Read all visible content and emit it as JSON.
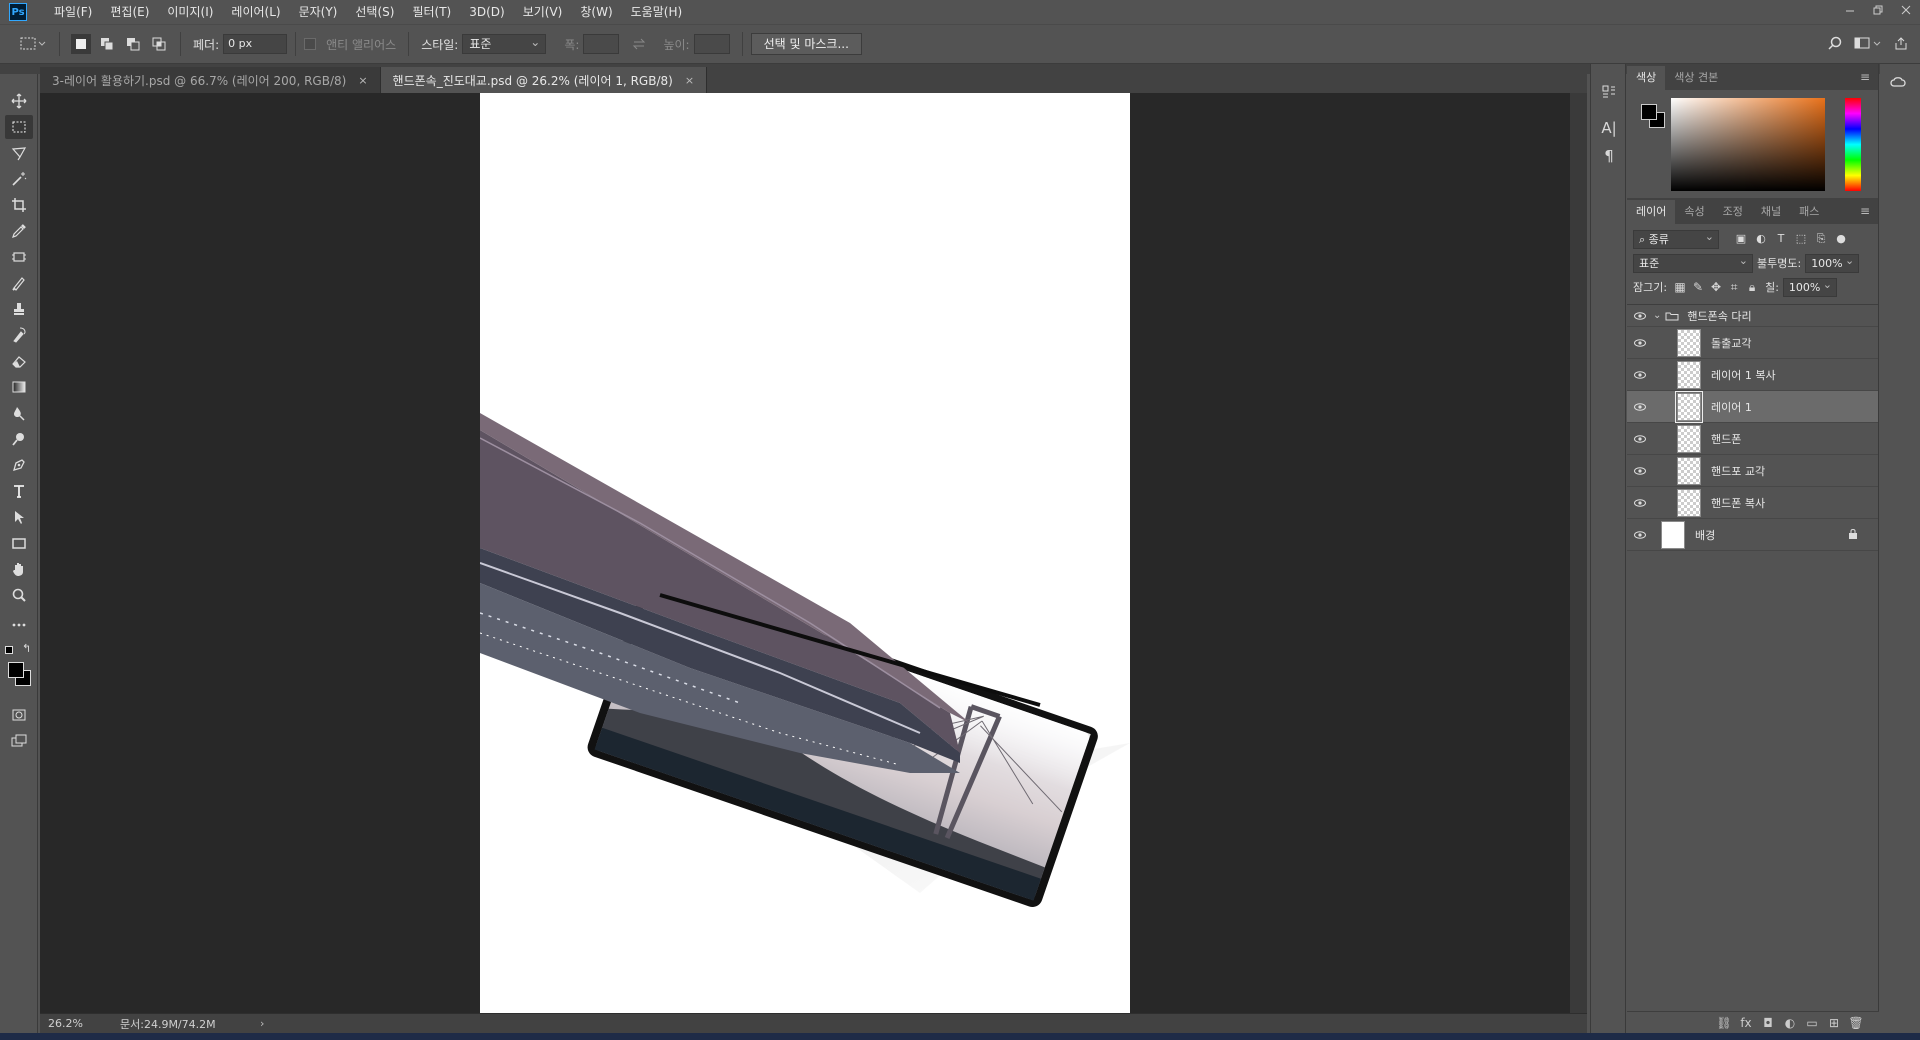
{
  "app": {
    "logo": "Ps"
  },
  "menu": [
    "파일(F)",
    "편집(E)",
    "이미지(I)",
    "레이어(L)",
    "문자(Y)",
    "선택(S)",
    "필터(T)",
    "3D(D)",
    "보기(V)",
    "창(W)",
    "도움말(H)"
  ],
  "options": {
    "feather_label": "페더:",
    "feather_value": "0 px",
    "antialias_label": "앤티 앨리어스",
    "style_label": "스타일:",
    "style_value": "표준",
    "width_label": "폭:",
    "height_label": "높이:",
    "select_mask_button": "선택 및 마스크..."
  },
  "tabs": [
    {
      "label": "3-레이어 활용하기.psd @ 66.7% (레이어 200, RGB/8)",
      "close": "×"
    },
    {
      "label": "핸드폰속_진도대교.psd @ 26.2% (레이어 1, RGB/8)",
      "close": "×"
    }
  ],
  "status": {
    "zoom": "26.2%",
    "doc_info": "문서:24.9M/74.2M",
    "arrow": "›"
  },
  "color_panel": {
    "tabs": [
      "색상",
      "색상 견본"
    ],
    "foreground": "#000000",
    "background": "#000000",
    "hue_color": "#e8711a"
  },
  "layers_panel": {
    "tabs": [
      "레이어",
      "속성",
      "조정",
      "채널",
      "패스"
    ],
    "filter_label": "종류",
    "blend_mode": "표준",
    "opacity_label": "불투명도:",
    "opacity_value": "100%",
    "lock_label": "잠그기:",
    "fill_label": "칠:",
    "fill_value": "100%",
    "group_name": "핸드폰속 다리",
    "layers": [
      {
        "name": "돌출교각",
        "selected": false
      },
      {
        "name": "레이어 1 복사",
        "selected": false
      },
      {
        "name": "레이어 1",
        "selected": true
      },
      {
        "name": "핸드폰",
        "selected": false
      },
      {
        "name": "핸드포 교각",
        "selected": false
      },
      {
        "name": "핸드폰 복사",
        "selected": false
      }
    ],
    "background_layer": "배경"
  }
}
